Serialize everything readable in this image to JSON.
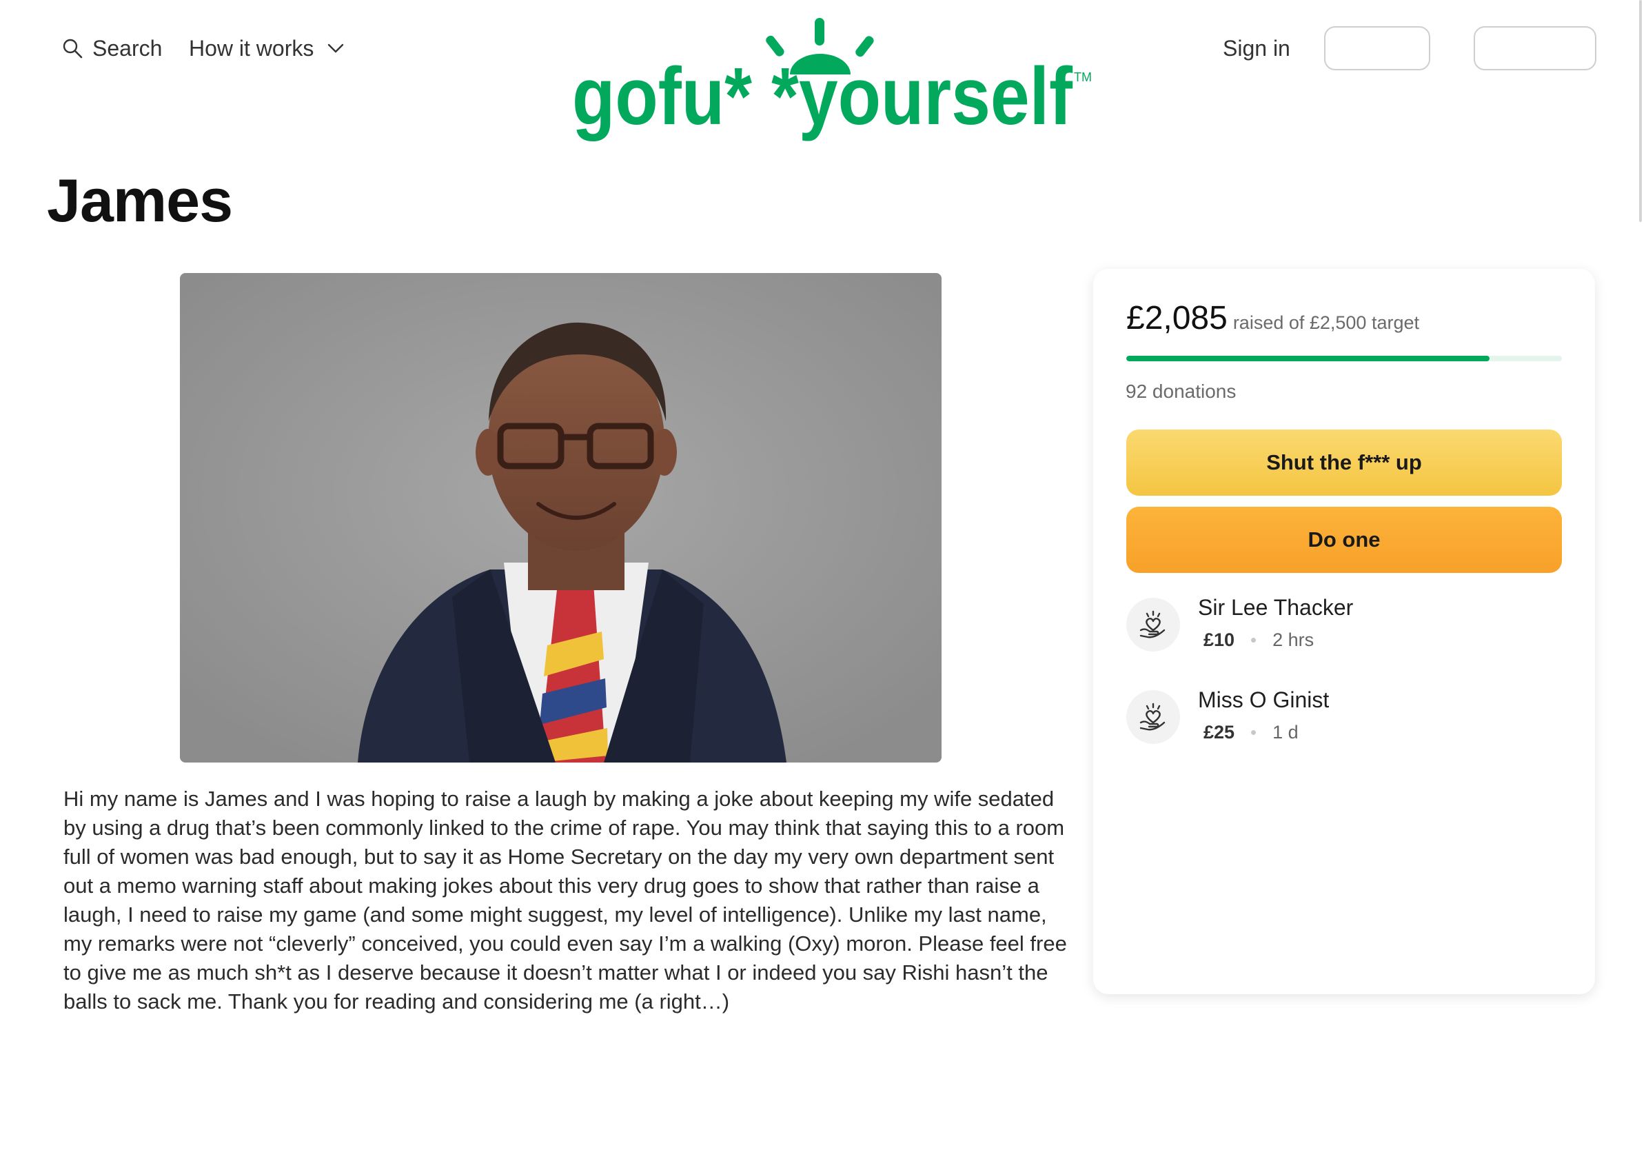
{
  "header": {
    "search_label": "Search",
    "how_it_works_label": "How it works",
    "logo_text": "gofu* *yourself",
    "logo_tm": "TM",
    "sign_in_label": "Sign in",
    "brand_color": "#02a95c"
  },
  "page": {
    "title": "James",
    "story": "Hi my name is James and I was hoping to raise a laugh by making a joke about keeping my wife sedated by using a drug that’s been commonly linked to the crime of rape. You may think that saying this to a room full of women was bad enough, but to say it as Home Secretary on the day my very own department sent out a memo warning staff about making jokes about this very drug goes to show that rather than raise a laugh, I need to raise my game (and some might suggest, my level of intelligence). Unlike my last name, my remarks were not “cleverly” conceived, you could even say I’m a walking (Oxy) moron. Please feel free to give me as much sh*t as I deserve because it doesn’t matter what I or indeed you say Rishi hasn’t the balls to sack me. Thank you for reading and considering me (a right…)"
  },
  "fundraiser": {
    "raised": "£2,085",
    "raised_suffix": "raised of £2,500 target",
    "progress_fraction": 0.834,
    "donation_count_text": "92 donations",
    "primary_button": "Shut the f*** up",
    "secondary_button": "Do one",
    "donations": [
      {
        "name": "Sir Lee Thacker",
        "amount": "£10",
        "time": "2 hrs"
      },
      {
        "name": "Miss O Ginist",
        "amount": "£25",
        "time": "1 d"
      }
    ]
  }
}
